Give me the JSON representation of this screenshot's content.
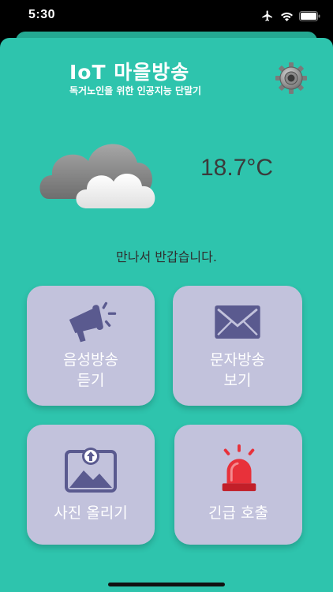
{
  "status_bar": {
    "time": "5:30",
    "icons": [
      "airplane-icon",
      "wifi-icon",
      "battery-icon"
    ]
  },
  "header": {
    "title": "IoT 마을방송",
    "subtitle": "독거노인을 위한 인공지능 단말기",
    "settings_icon": "gear-icon"
  },
  "weather": {
    "icon": "cloudy-icon",
    "temperature": "18.7°C"
  },
  "greeting": "만나서 반갑습니다.",
  "tiles": [
    {
      "line1": "음성방송",
      "line2": "듣기",
      "icon": "megaphone-icon"
    },
    {
      "line1": "문자방송",
      "line2": "보기",
      "icon": "envelope-icon"
    },
    {
      "line1": "사진 올리기",
      "icon": "photo-upload-icon"
    },
    {
      "line1": "긴급 호출",
      "icon": "siren-icon"
    }
  ],
  "colors": {
    "background": "#2ec4ad",
    "tile": "#c2c2dc",
    "tile_icon": "#5a5a8f",
    "siren": "#e8313a"
  }
}
